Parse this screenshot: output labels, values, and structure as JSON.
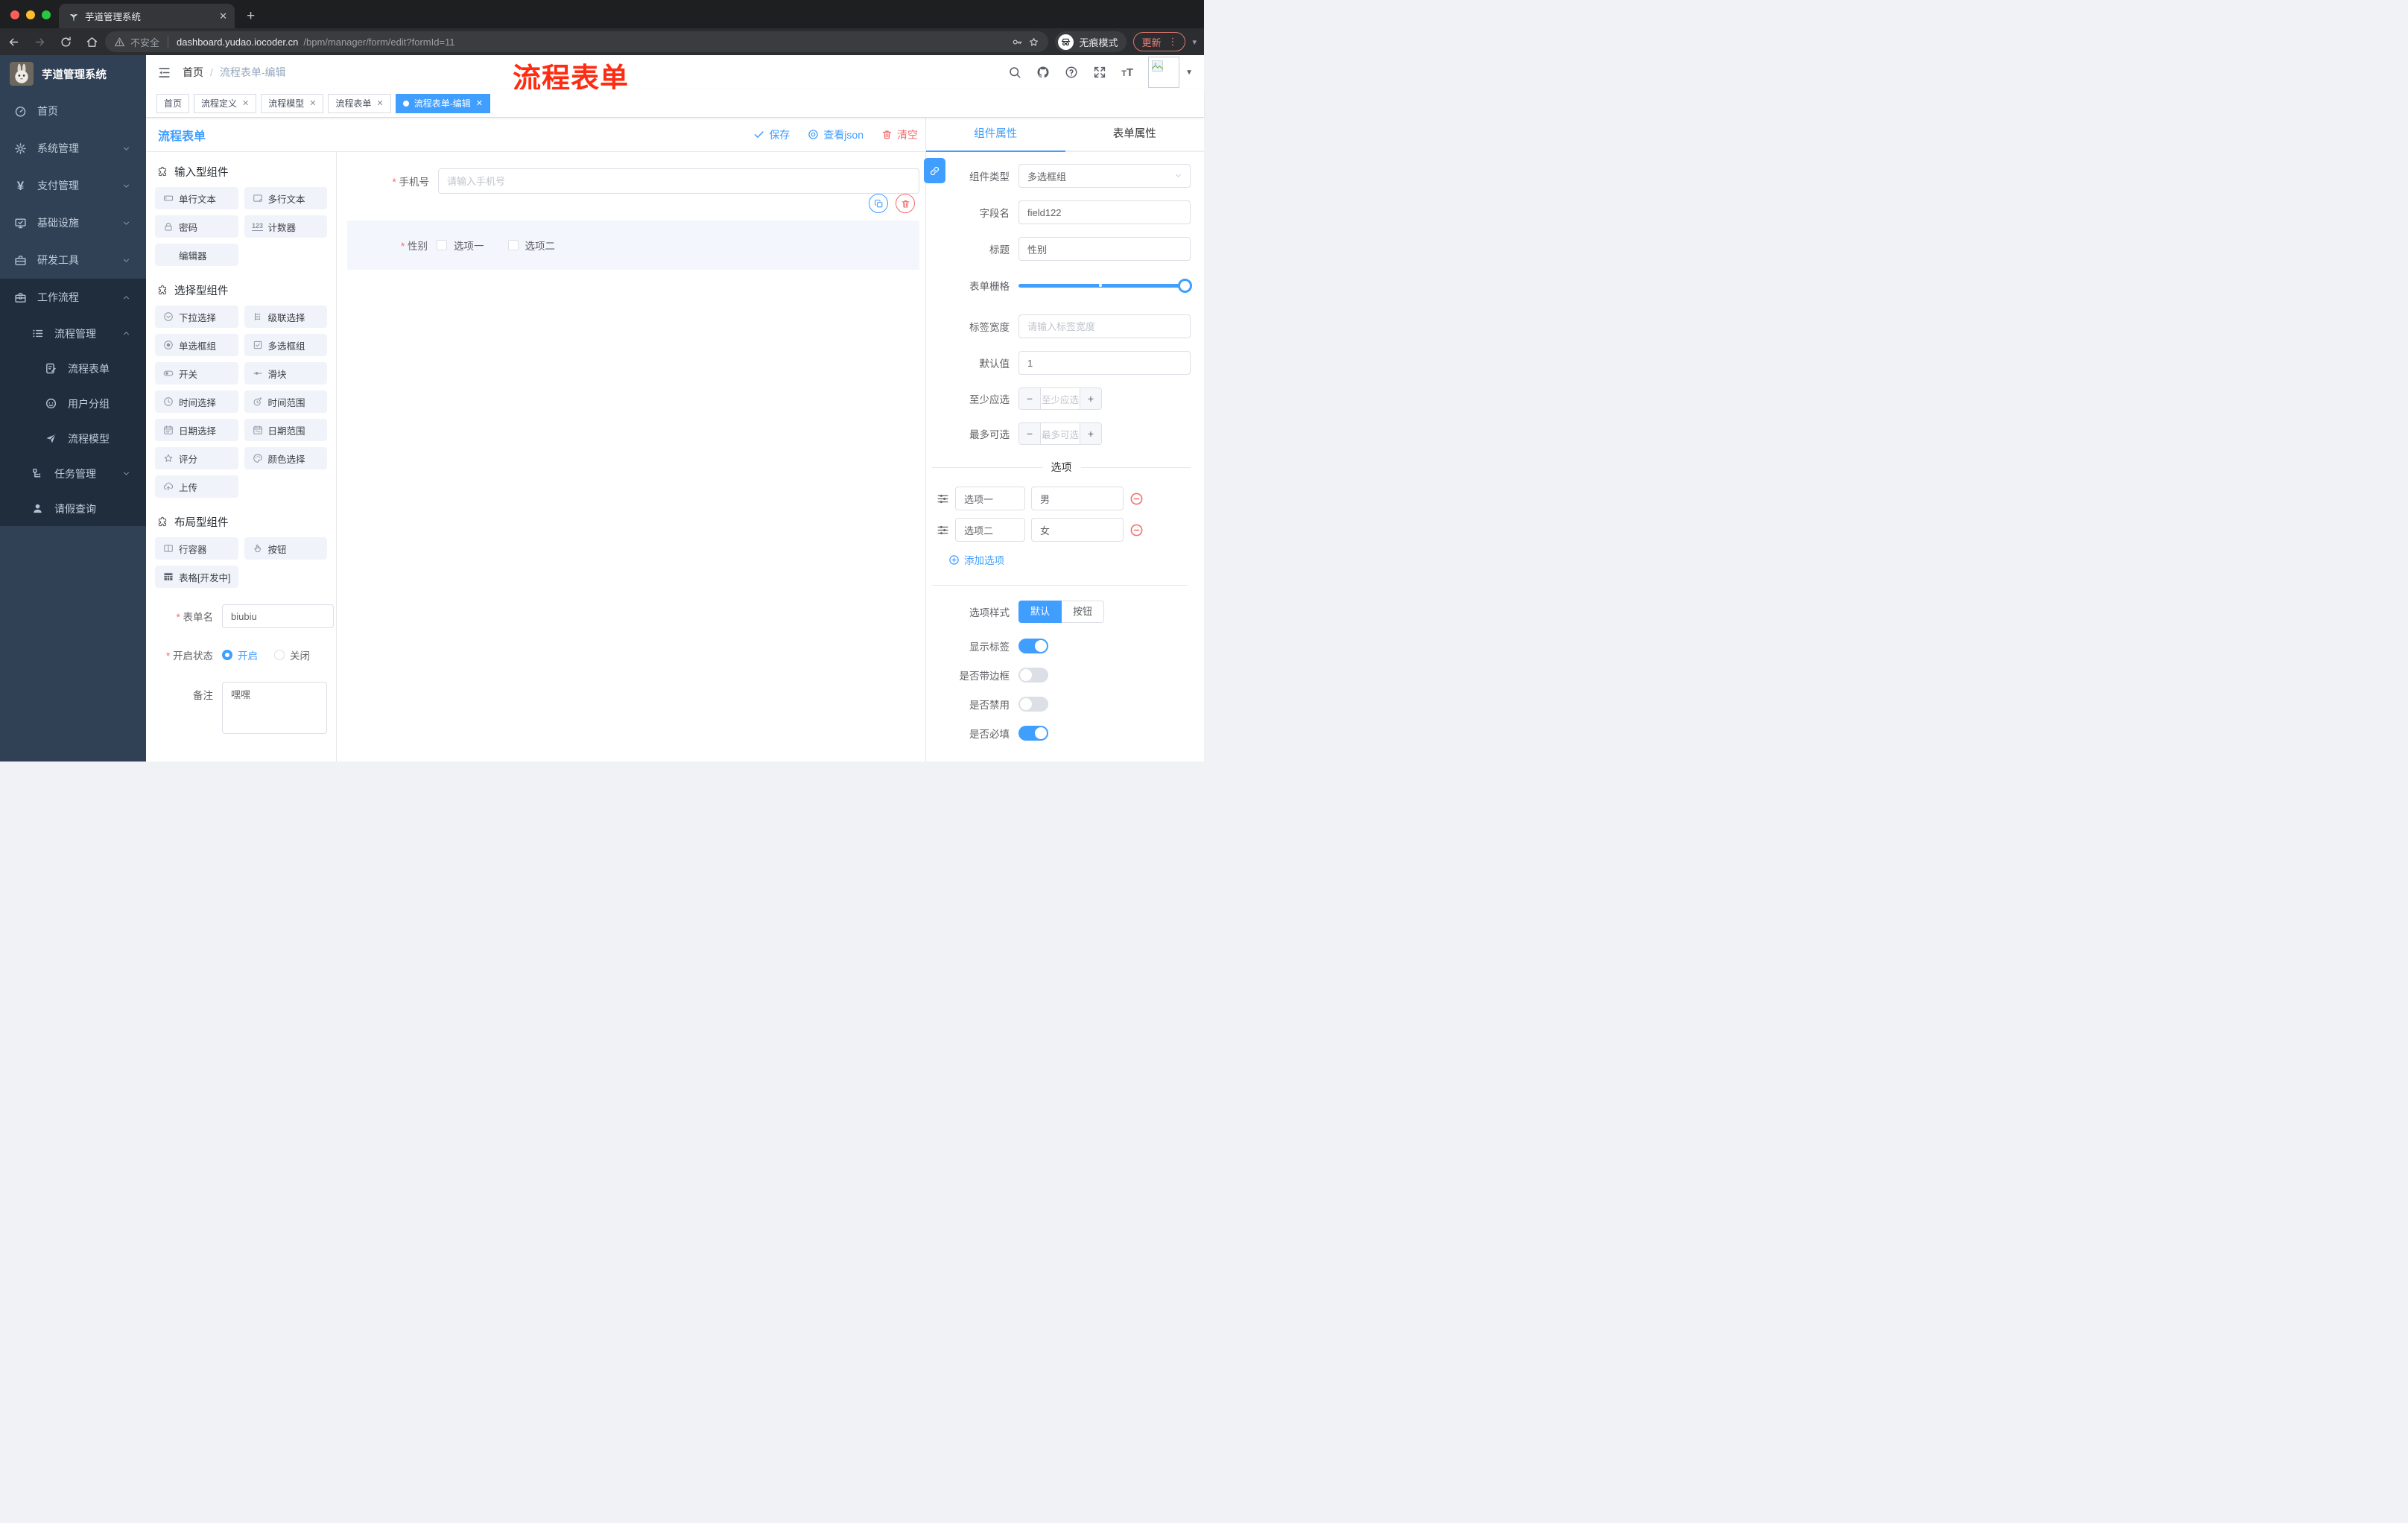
{
  "browser": {
    "tab_title": "芋道管理系统",
    "close_glyph": "✕",
    "newtab_glyph": "+",
    "nav_icons": [
      "back-icon",
      "forward-icon",
      "reload-icon",
      "home-icon"
    ],
    "url_warning": "不安全",
    "url_domain": "dashboard.yudao.iocoder.cn",
    "url_path": "/bpm/manager/form/edit?formId=11",
    "incognito_label": "无痕模式",
    "update_label": "更新",
    "dots_glyph": "⋮",
    "caret_glyph": "▾",
    "traffic_colors": [
      "#ff5f57",
      "#febc2e",
      "#28c840"
    ]
  },
  "sidebar": {
    "logo_title": "芋道管理系统",
    "items": [
      {
        "label": "首页",
        "icon": "dashboard-icon",
        "level": 1,
        "dark": false,
        "expand": null
      },
      {
        "label": "系统管理",
        "icon": "gear-icon",
        "level": 1,
        "dark": false,
        "expand": "down"
      },
      {
        "label": "支付管理",
        "icon": "yen-icon",
        "level": 1,
        "dark": false,
        "expand": "down"
      },
      {
        "label": "基础设施",
        "icon": "monitor-icon",
        "level": 1,
        "dark": false,
        "expand": "down"
      },
      {
        "label": "研发工具",
        "icon": "toolbox-icon",
        "level": 1,
        "dark": false,
        "expand": "down"
      },
      {
        "label": "工作流程",
        "icon": "briefcase-icon",
        "level": 1,
        "dark": true,
        "expand": "up"
      },
      {
        "label": "流程管理",
        "icon": "list-icon",
        "level": 2,
        "dark": true,
        "expand": "up"
      },
      {
        "label": "流程表单",
        "icon": "form-doc-icon",
        "level": 3,
        "dark": true,
        "expand": null
      },
      {
        "label": "用户分组",
        "icon": "user-group-icon",
        "level": 3,
        "dark": true,
        "expand": null
      },
      {
        "label": "流程模型",
        "icon": "paper-plane-icon",
        "level": 3,
        "dark": true,
        "expand": null
      },
      {
        "label": "任务管理",
        "icon": "tree-icon",
        "level": 2,
        "dark": true,
        "expand": "down"
      },
      {
        "label": "请假查询",
        "icon": "user-icon",
        "level": 2,
        "dark": true,
        "expand": null
      }
    ]
  },
  "header": {
    "breadcrumb_home": "首页",
    "breadcrumb_sep": "/",
    "breadcrumb_current": "流程表单-编辑",
    "annotation": "流程表单",
    "annotation_color": "#fe2c12",
    "icons": [
      "search-icon",
      "github-icon",
      "question-icon",
      "fullscreen-icon",
      "fontsize-icon"
    ]
  },
  "tags": [
    {
      "label": "首页",
      "closable": false,
      "active": false
    },
    {
      "label": "流程定义",
      "closable": true,
      "active": false
    },
    {
      "label": "流程模型",
      "closable": true,
      "active": false
    },
    {
      "label": "流程表单",
      "closable": true,
      "active": false
    },
    {
      "label": "流程表单-编辑",
      "closable": true,
      "active": true
    }
  ],
  "designer": {
    "title": "流程表单",
    "actions": [
      {
        "label": "保存",
        "icon": "check-icon",
        "type": "primary"
      },
      {
        "label": "查看json",
        "icon": "view-icon",
        "type": "primary"
      },
      {
        "label": "清空",
        "icon": "trash-icon",
        "type": "danger"
      }
    ]
  },
  "components_panel": {
    "sections": [
      {
        "title": "输入型组件",
        "icon": "puzzle-icon",
        "items": [
          {
            "label": "单行文本",
            "icon": "input-icon"
          },
          {
            "label": "多行文本",
            "icon": "textarea-icon"
          },
          {
            "label": "密码",
            "icon": "lock-icon"
          },
          {
            "label": "计数器",
            "icon": "counter-icon"
          },
          {
            "label": "编辑器",
            "icon": null
          }
        ]
      },
      {
        "title": "选择型组件",
        "icon": "puzzle-icon",
        "items": [
          {
            "label": "下拉选择",
            "icon": "select-icon"
          },
          {
            "label": "级联选择",
            "icon": "cascader-icon"
          },
          {
            "label": "单选框组",
            "icon": "radio-icon"
          },
          {
            "label": "多选框组",
            "icon": "checkbox-icon"
          },
          {
            "label": "开关",
            "icon": "switch-icon"
          },
          {
            "label": "滑块",
            "icon": "slider-icon"
          },
          {
            "label": "时间选择",
            "icon": "time-icon"
          },
          {
            "label": "时间范围",
            "icon": "time-range-icon"
          },
          {
            "label": "日期选择",
            "icon": "date-icon"
          },
          {
            "label": "日期范围",
            "icon": "date-range-icon"
          },
          {
            "label": "评分",
            "icon": "rate-icon"
          },
          {
            "label": "颜色选择",
            "icon": "palette-icon"
          },
          {
            "label": "上传",
            "icon": "upload-icon"
          }
        ]
      },
      {
        "title": "布局型组件",
        "icon": "puzzle-icon",
        "items": [
          {
            "label": "行容器",
            "icon": "columns-icon"
          },
          {
            "label": "按钮",
            "icon": "click-icon"
          },
          {
            "label": "表格[开发中]",
            "icon": "table-icon"
          }
        ]
      }
    ],
    "form": {
      "name_label": "表单名",
      "name_value": "biubiu",
      "status_label": "开启状态",
      "status_options": [
        {
          "label": "开启",
          "checked": true
        },
        {
          "label": "关闭",
          "checked": false
        }
      ],
      "remark_label": "备注",
      "remark_value": "嘿嘿"
    }
  },
  "canvas": {
    "phone_label": "手机号",
    "phone_placeholder": "请输入手机号",
    "gender_label": "性别",
    "gender_options": [
      "选项一",
      "选项二"
    ]
  },
  "props_panel": {
    "tabs": [
      {
        "label": "组件属性",
        "active": true
      },
      {
        "label": "表单属性",
        "active": false
      }
    ],
    "type_label": "组件类型",
    "type_value": "多选框组",
    "field_label": "字段名",
    "field_value": "field122",
    "title_label": "标题",
    "title_value": "性别",
    "grid_label": "表单栅格",
    "label_width_label": "标签宽度",
    "label_width_placeholder": "请输入标签宽度",
    "default_label": "默认值",
    "default_value": "1",
    "min_label": "至少应选",
    "min_placeholder": "至少应选",
    "max_label": "最多可选",
    "max_placeholder": "最多可选",
    "options_title": "选项",
    "options": [
      {
        "label": "选项一",
        "value": "男"
      },
      {
        "label": "选项二",
        "value": "女"
      }
    ],
    "add_option_label": "添加选项",
    "style_label": "选项样式",
    "style_choices": [
      {
        "label": "默认",
        "active": true
      },
      {
        "label": "按钮",
        "active": false
      }
    ],
    "switch_rows": [
      {
        "label": "显示标签",
        "on": true
      },
      {
        "label": "是否带边框",
        "on": false
      },
      {
        "label": "是否禁用",
        "on": false
      },
      {
        "label": "是否必填",
        "on": true
      }
    ]
  },
  "colors": {
    "accent": "#409eff",
    "danger": "#f56c6c",
    "sidebar_bg": "#304156",
    "sidebar_sub_bg": "#1f2d3d"
  }
}
